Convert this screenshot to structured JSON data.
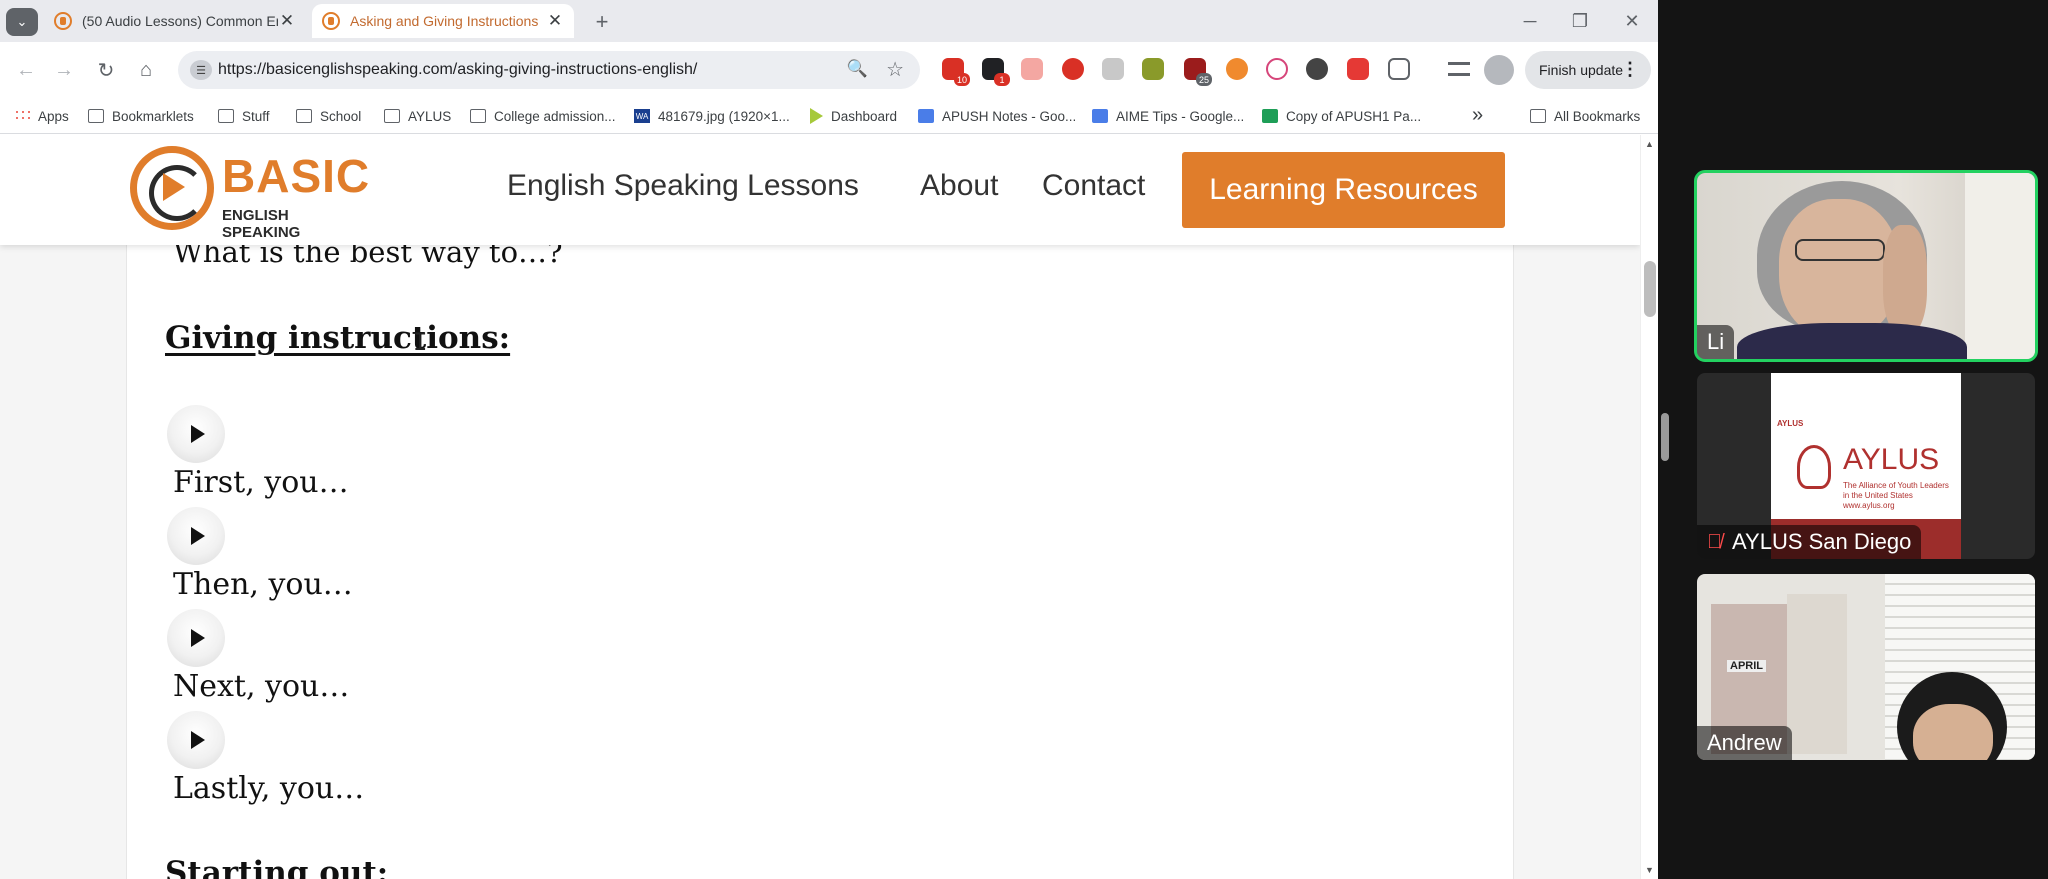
{
  "browser": {
    "tabs": [
      {
        "title": "(50 Audio Lessons) Common En",
        "active": false
      },
      {
        "title": "Asking and Giving Instructions",
        "active": true
      }
    ],
    "url": "https://basicenglishspeaking.com/asking-giving-instructions-english/",
    "extension_badges": {
      "mail": "10",
      "ext2": "1",
      "ext3": "25"
    },
    "finish_update_label": "Finish update",
    "bookmarks": [
      {
        "label": "Apps",
        "icon": "apps-icon"
      },
      {
        "label": "Bookmarklets",
        "icon": "folder-icon"
      },
      {
        "label": "Stuff",
        "icon": "folder-icon"
      },
      {
        "label": "School",
        "icon": "folder-icon"
      },
      {
        "label": "AYLUS",
        "icon": "folder-icon"
      },
      {
        "label": "College admission...",
        "icon": "folder-icon"
      },
      {
        "label": "481679.jpg (1920×1...",
        "icon": "image-icon"
      },
      {
        "label": "Dashboard",
        "icon": "dashboard-icon"
      },
      {
        "label": "APUSH Notes - Goo...",
        "icon": "docs-icon"
      },
      {
        "label": "AIME Tips - Google...",
        "icon": "docs-icon"
      },
      {
        "label": "Copy of APUSH1 Pa...",
        "icon": "sheets-icon"
      }
    ],
    "all_bookmarks_label": "All Bookmarks"
  },
  "site": {
    "logo_main": "BASIC",
    "logo_sub": "ENGLISH SPEAKING",
    "nav": [
      "English Speaking Lessons",
      "About",
      "Contact"
    ],
    "cta": "Learning Resources",
    "accent_color": "#e07d2b"
  },
  "lesson": {
    "previous_line": "What is the best way to…?",
    "heading": "Giving instructions:",
    "phrases": [
      "First, you…",
      "Then, you…",
      "Next, you…",
      "Lastly, you…"
    ],
    "next_heading": "Starting out:"
  },
  "call": {
    "participants": [
      {
        "name": "Li",
        "speaking": true,
        "muted": false
      },
      {
        "name": "AYLUS San Diego",
        "speaking": false,
        "muted": true
      },
      {
        "name": "Andrew",
        "speaking": false,
        "muted": false
      }
    ],
    "aylus_slide": {
      "small_label": "AYLUS",
      "title": "AYLUS",
      "tagline": "The Alliance of Youth Leaders in the United States",
      "url": "www.aylus.org"
    },
    "andrew_calendar_text": "APRIL"
  }
}
